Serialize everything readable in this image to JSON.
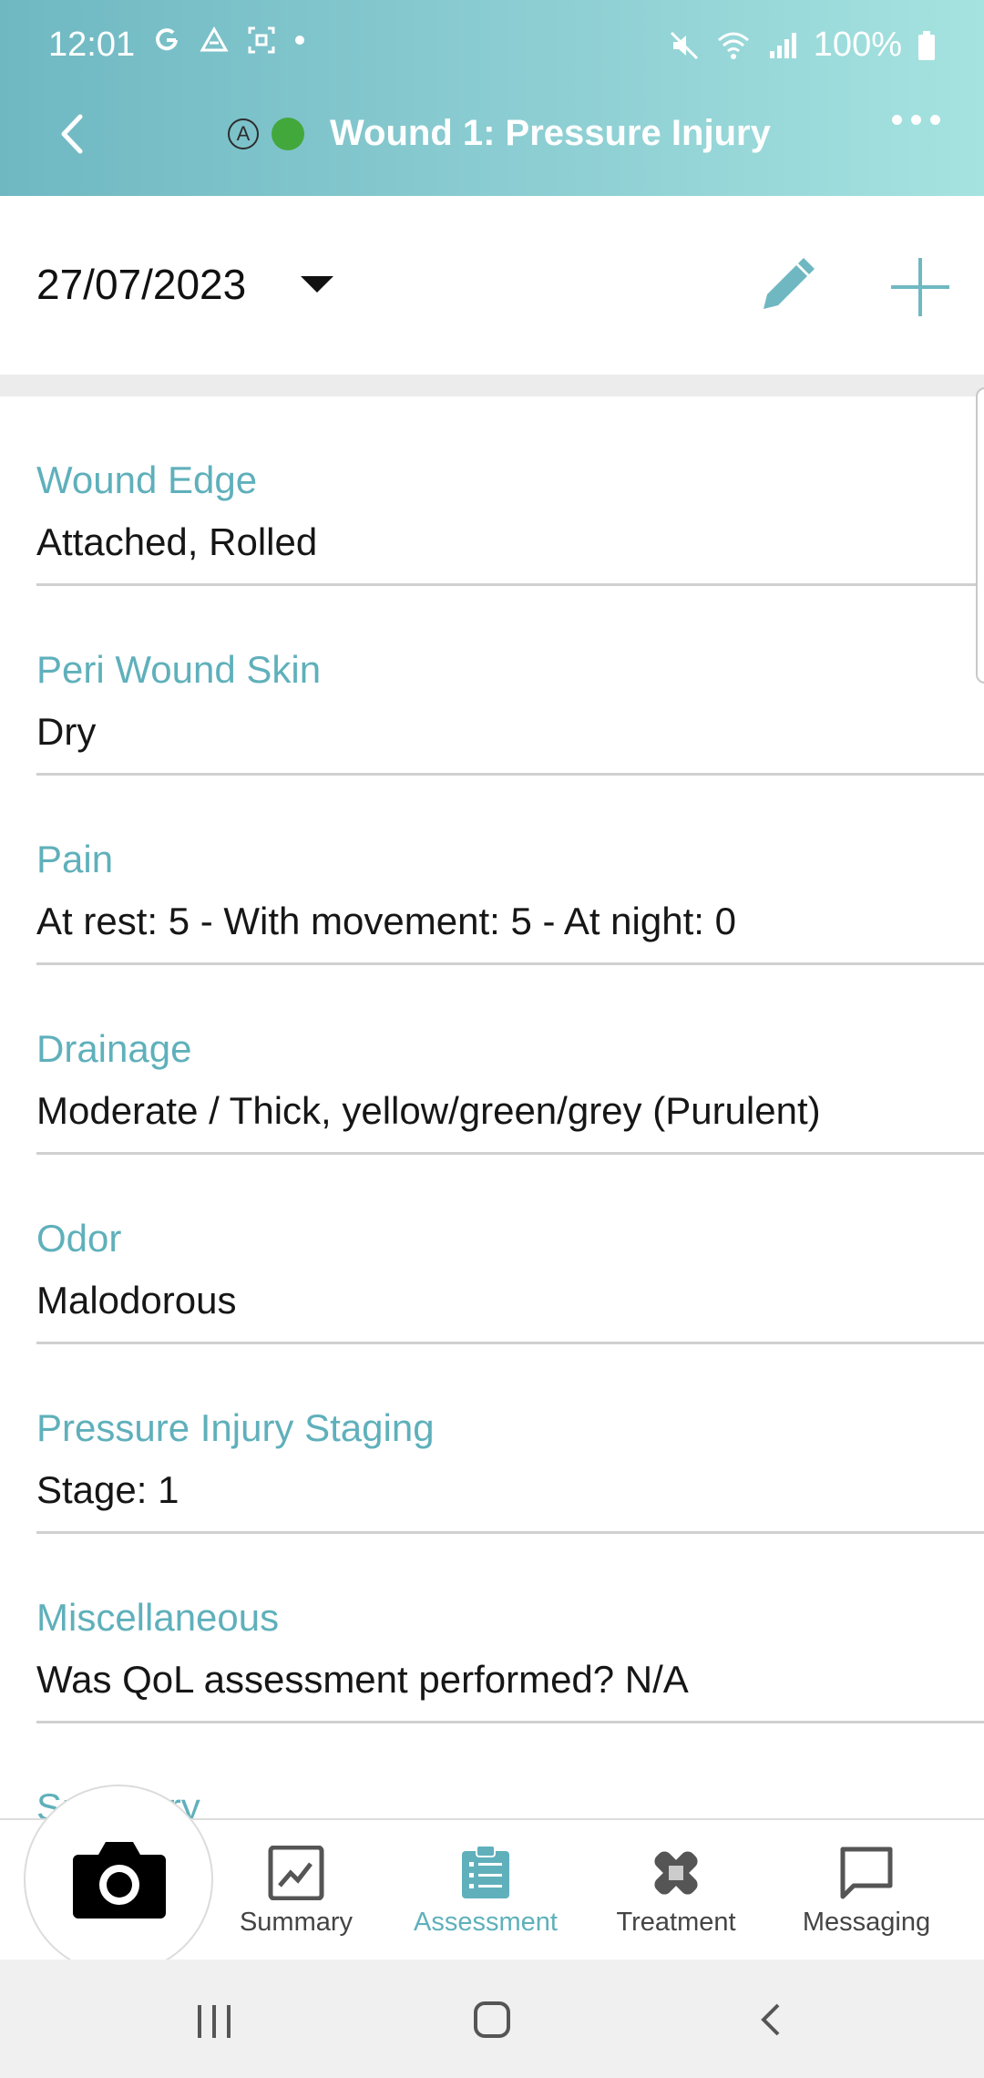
{
  "status_bar": {
    "time": "12:01",
    "battery": "100%",
    "icons": [
      "google-icon",
      "drive-icon",
      "screenshot-icon",
      "dot-icon",
      "mute-icon",
      "wifi-icon",
      "signal-icon",
      "battery-icon"
    ]
  },
  "header": {
    "badge_letter": "A",
    "title": "Wound 1: Pressure Injury",
    "status_dot_color": "#43a83b",
    "accent_color": "#5fb0bb"
  },
  "date_bar": {
    "date": "27/07/2023"
  },
  "assessment": [
    {
      "label": "Wound Edge",
      "value": "Attached, Rolled"
    },
    {
      "label": "Peri Wound Skin",
      "value": "Dry"
    },
    {
      "label": "Pain",
      "value": "At rest: 5 - With movement: 5 - At night: 0"
    },
    {
      "label": "Drainage",
      "value": "Moderate / Thick, yellow/green/grey (Purulent)"
    },
    {
      "label": "Odor",
      "value": "Malodorous"
    },
    {
      "label": "Pressure Injury Staging",
      "value": "Stage: 1"
    },
    {
      "label": "Miscellaneous",
      "value": "Was QoL assessment performed? N/A"
    },
    {
      "label": "Summary",
      "value": ""
    }
  ],
  "bottom_nav": {
    "tabs": [
      {
        "label": "Summary",
        "icon": "chart-icon"
      },
      {
        "label": "Assessment",
        "icon": "clipboard-icon",
        "active": true
      },
      {
        "label": "Treatment",
        "icon": "bandage-icon"
      },
      {
        "label": "Messaging",
        "icon": "chat-icon"
      }
    ]
  }
}
